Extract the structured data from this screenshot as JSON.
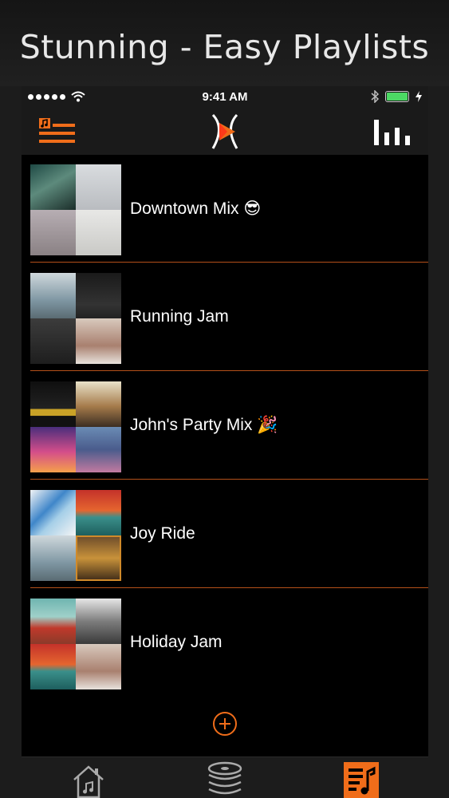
{
  "headline": "Stunning - Easy Playlists",
  "status_bar": {
    "time": "9:41 AM",
    "signal_icon": "signal-dots-icon",
    "wifi_icon": "wifi-icon",
    "bluetooth_icon": "bluetooth-icon",
    "battery_icon": "battery-charging-icon"
  },
  "nav": {
    "left_icon": "playlist-menu-icon",
    "center_icon": "app-logo-icon",
    "right_icon": "equalizer-icon"
  },
  "playlists": [
    {
      "title": "Downtown Mix 😎"
    },
    {
      "title": "Running Jam"
    },
    {
      "title": "John's Party Mix 🎉"
    },
    {
      "title": "Joy Ride"
    },
    {
      "title": "Holiday Jam"
    }
  ],
  "add_icon": "add-circle-icon",
  "tabs": [
    {
      "icon": "home-music-icon"
    },
    {
      "icon": "library-stack-icon"
    },
    {
      "icon": "playlists-icon",
      "active": true
    }
  ],
  "colors": {
    "accent": "#f06d1a",
    "background": "#000000",
    "bars": "#1a1a1a",
    "divider": "#b4501a"
  }
}
